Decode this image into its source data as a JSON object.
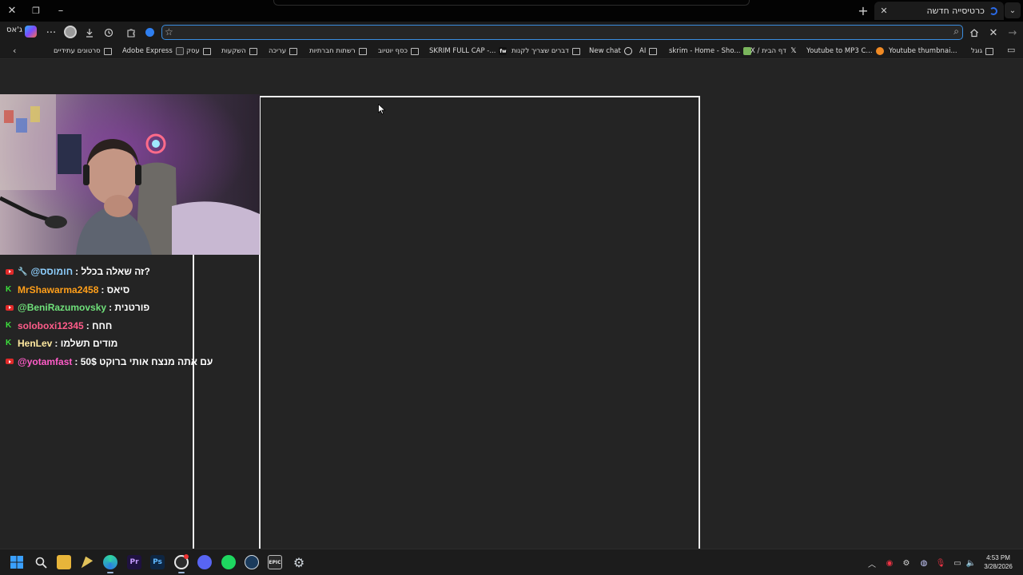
{
  "window": {
    "tab_title": "כרטיסייה חדשה",
    "buttons": {
      "close": "✕",
      "restore": "❐",
      "minimize": "–"
    }
  },
  "toolbar": {
    "profile_label": "ג'אס",
    "more": "···",
    "address_value": "",
    "icons": [
      "more-icon",
      "account-icon",
      "download-icon",
      "history-icon",
      "extensions-icon",
      "star-icon",
      "search-icon",
      "home-icon",
      "stop-icon",
      "forward-icon"
    ]
  },
  "bookmarks": [
    {
      "label": "סרטונים עתידיים",
      "icon": "folder"
    },
    {
      "label": "Adobe Express",
      "icon": "adobe"
    },
    {
      "label": "עסק",
      "icon": "folder"
    },
    {
      "label": "השקעות",
      "icon": "folder"
    },
    {
      "label": "עריכה",
      "icon": "folder"
    },
    {
      "label": "רשתות חברתיות",
      "icon": "folder"
    },
    {
      "label": "כסף יוטיוב",
      "icon": "folder"
    },
    {
      "label": "SKRIM FULL CAP -...",
      "icon": "fw"
    },
    {
      "label": "דברים שצריך לקנות",
      "icon": "folder"
    },
    {
      "label": "New chat",
      "icon": "openai"
    },
    {
      "label": "AI",
      "icon": "folder"
    },
    {
      "label": "skrim - Home - Sho...",
      "icon": "shopify"
    },
    {
      "label": "X / דף הבית",
      "icon": "x"
    },
    {
      "label": "Youtube to MP3 C...",
      "icon": "orange"
    },
    {
      "label": "Youtube thumbnai...",
      "icon": "none"
    },
    {
      "label": "גוגל",
      "icon": "folder"
    }
  ],
  "chat": [
    {
      "platform": "youtube",
      "mod": true,
      "user": "@חומוסס",
      "user_color": "#8fd0ff",
      "message": ": זה שאלה בכלל?"
    },
    {
      "platform": "kick",
      "mod": false,
      "user": "MrShawarma2458",
      "user_color": "#ff9f1a",
      "message": ": סיאס"
    },
    {
      "platform": "youtube",
      "mod": false,
      "user": "@BeniRazumovsky",
      "user_color": "#6fe07a",
      "message": ": פורטנית"
    },
    {
      "platform": "kick",
      "mod": false,
      "user": "soloboxi12345",
      "user_color": "#ff5c8a",
      "message": ": חחח"
    },
    {
      "platform": "kick",
      "mod": false,
      "user": "HenLev",
      "user_color": "#ffe9a0",
      "message": ": מודים תשלמו"
    },
    {
      "platform": "youtube",
      "mod": false,
      "user": "@yotamfast",
      "user_color": "#ff5cc8",
      "message": ": 50$ עם אתה מנצח אותי ברוקט"
    }
  ],
  "taskbar": {
    "apps": [
      "windows-start",
      "search",
      "file-explorer",
      "paint",
      "edge",
      "premiere-pro",
      "photoshop",
      "obs",
      "discord",
      "spotify",
      "steam",
      "epic-games",
      "settings"
    ],
    "premiere_label": "Pr",
    "photoshop_label": "Ps",
    "epic_label": "EPIC",
    "time": "4:53 PM",
    "date": "3/28/2026"
  },
  "colors": {
    "accent": "#3a8de0",
    "background": "#242424",
    "frame": "#ececec"
  }
}
